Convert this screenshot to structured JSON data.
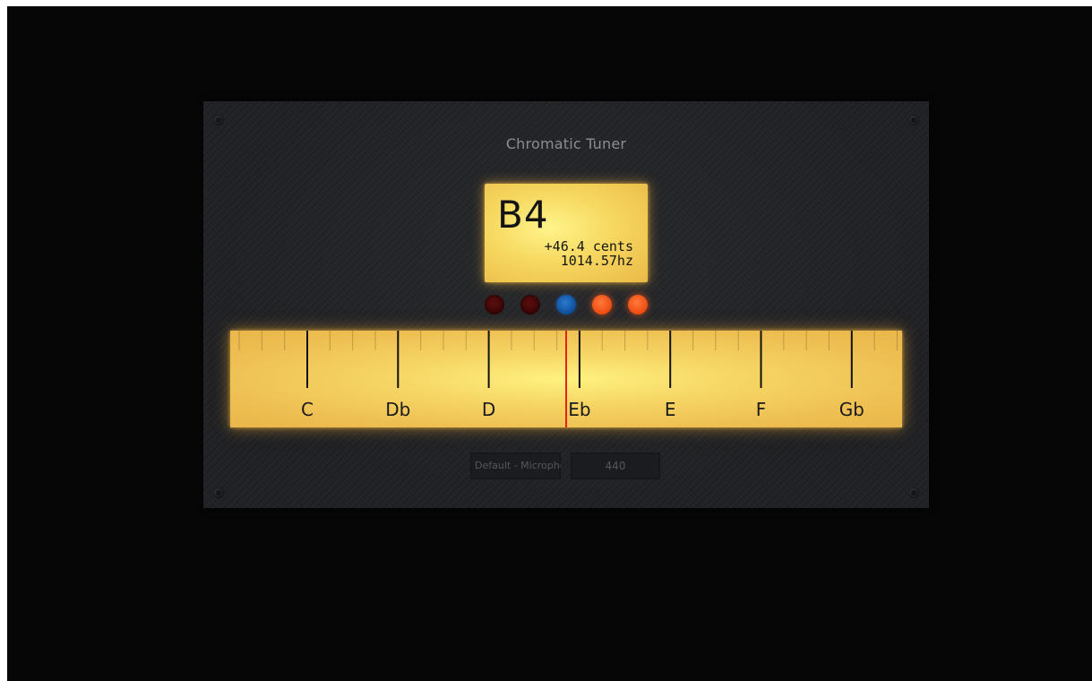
{
  "app": {
    "title": "Chromatic Tuner"
  },
  "display": {
    "note": "B4",
    "cents": "+46.4 cents",
    "frequency": "1014.57hz"
  },
  "indicators": [
    {
      "name": "flat-far",
      "state": "off",
      "color": "#5a0d0d"
    },
    {
      "name": "flat-near",
      "state": "off",
      "color": "#5a0d0d"
    },
    {
      "name": "in-tune",
      "state": "on",
      "color": "#2b79cf"
    },
    {
      "name": "sharp-near",
      "state": "on",
      "color": "#f04a12"
    },
    {
      "name": "sharp-far",
      "state": "on",
      "color": "#f04a12"
    }
  ],
  "scale": {
    "notes": [
      "C",
      "Db",
      "D",
      "Eb",
      "E",
      "F",
      "Gb"
    ],
    "needle_semitone_position": 2.855
  },
  "controls": {
    "input_device": "Default - Microphone",
    "reference_frequency": "440"
  },
  "colors": {
    "lcd": "#f6d860",
    "needle": "#e8221a",
    "panel": "#1f2023",
    "background": "#060606"
  }
}
